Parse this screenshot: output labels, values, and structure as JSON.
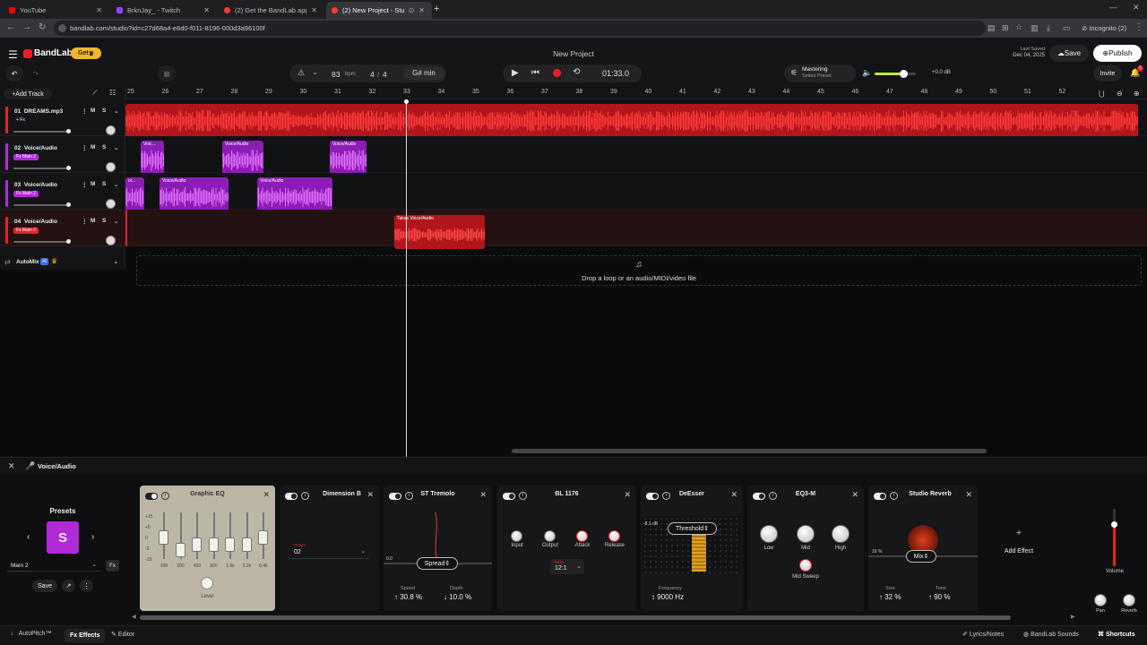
{
  "browser": {
    "tabs": [
      {
        "title": "YouTube",
        "color": "#ff0000"
      },
      {
        "title": "BrknJay_ - Twitch",
        "color": "#9146ff"
      },
      {
        "title": "(2) Get the BandLab app on yo",
        "color": "#ff3b30"
      },
      {
        "title": "(2) New Project - Studio",
        "color": "#ff3b30"
      }
    ],
    "url": "bandlab.com/studio?id=c27d68a4-e8d0-f011-8196-000d3a96100f",
    "incognito": "Incognito (2)"
  },
  "header": {
    "logo": "BandLab",
    "get_label": "Get",
    "project_title": "New Project",
    "last_saved_label": "Last Saved",
    "last_saved_date": "Dec 04, 2025",
    "save": "Save",
    "publish": "Publish",
    "bpm": "83",
    "bpm_unit": "bpm",
    "time_sig_num": "4",
    "time_sig_sep": "/",
    "time_sig_den": "4",
    "key": "G# min",
    "time": "01:33.0",
    "mastering": "Mastering",
    "mastering_sub": "Select Preset",
    "volume_db": "+0.0 dB",
    "invite": "Invite",
    "notif_count": "1"
  },
  "timeline": {
    "add_track": "Add Track",
    "ruler": [
      "25",
      "26",
      "27",
      "28",
      "29",
      "30",
      "31",
      "32",
      "33",
      "34",
      "35",
      "36",
      "37",
      "38",
      "39",
      "40",
      "41",
      "42",
      "43",
      "44",
      "45",
      "46",
      "47",
      "48",
      "49",
      "50",
      "51",
      "52"
    ],
    "tracks": [
      {
        "num": "01",
        "name": "DREAMS.mp3",
        "tag": "+ Fx",
        "color": "#e0242a"
      },
      {
        "num": "02",
        "name": "Voice/Audio",
        "tag": "Fx Main 2",
        "color": "#b12ad8"
      },
      {
        "num": "03",
        "name": "Voice/Audio",
        "tag": "Fx Main 2",
        "color": "#b12ad8"
      },
      {
        "num": "04",
        "name": "Voice/Audio",
        "tag": "Fx Main 2",
        "color": "#e0242a"
      }
    ],
    "m": "M",
    "s": "S",
    "automix": "AutoMix",
    "ai": "AI",
    "clips": {
      "lane2": [
        "Voic...",
        "Voice/Audio",
        "Voice/Audio"
      ],
      "lane3": [
        "oi...",
        "Voice/Audio",
        "Voice/Audio"
      ],
      "lane4": "Takes Voice/Audio"
    },
    "drop_text": "Drop a loop or an audio/MIDI/video file"
  },
  "fx": {
    "track_name": "Voice/Audio",
    "presets_title": "Presets",
    "preset_letter": "S",
    "preset_name": "Main 2",
    "fx_badge": "Fx",
    "save": "Save",
    "graphic_eq": {
      "title": "Graphic EQ",
      "scale": [
        "+15",
        "+5",
        "0",
        "-5",
        "-15"
      ],
      "bands": [
        "100",
        "200",
        "400",
        "800",
        "1.6k",
        "3.2k",
        "6.4k"
      ],
      "level": "Level"
    },
    "dimension_b": {
      "title": "Dimension B",
      "preset_label": "Preset",
      "preset_value": "02"
    },
    "st_tremolo": {
      "title": "ST Tremolo",
      "zero": "0.0",
      "spread": "Spread",
      "speed_label": "Speed",
      "speed": "30.8 %",
      "depth_label": "Depth",
      "depth": "10.0 %"
    },
    "bl1176": {
      "title": "BL 1176",
      "input": "Input",
      "output": "Output",
      "attack": "Attack",
      "release": "Release",
      "ratio_label": "Ratio",
      "ratio": "12:1"
    },
    "deesser": {
      "title": "DeEsser",
      "db": "-8.1 dB",
      "threshold": "Threshold",
      "freq_label": "Frequency",
      "freq": "9000 Hz"
    },
    "eq3m": {
      "title": "EQ3-M",
      "low": "Low",
      "mid": "Mid",
      "high": "High",
      "mid_sweep": "Mid Sweep"
    },
    "reverb": {
      "title": "Studio Reverb",
      "pct": "16 %",
      "mix": "Mix",
      "size_label": "Size",
      "size": "32 %",
      "tone_label": "Tone",
      "tone": "90 %"
    },
    "add_effect": "Add Effect",
    "volume": "Volume",
    "pan": "Pan",
    "reverb_small": "Reverb"
  },
  "bottom": {
    "autopitch": "AutoPitch™",
    "effects": "Effects",
    "editor": "Editor",
    "lyrics": "Lyrics/Notes",
    "sounds": "BandLab Sounds",
    "shortcuts": "Shortcuts"
  }
}
